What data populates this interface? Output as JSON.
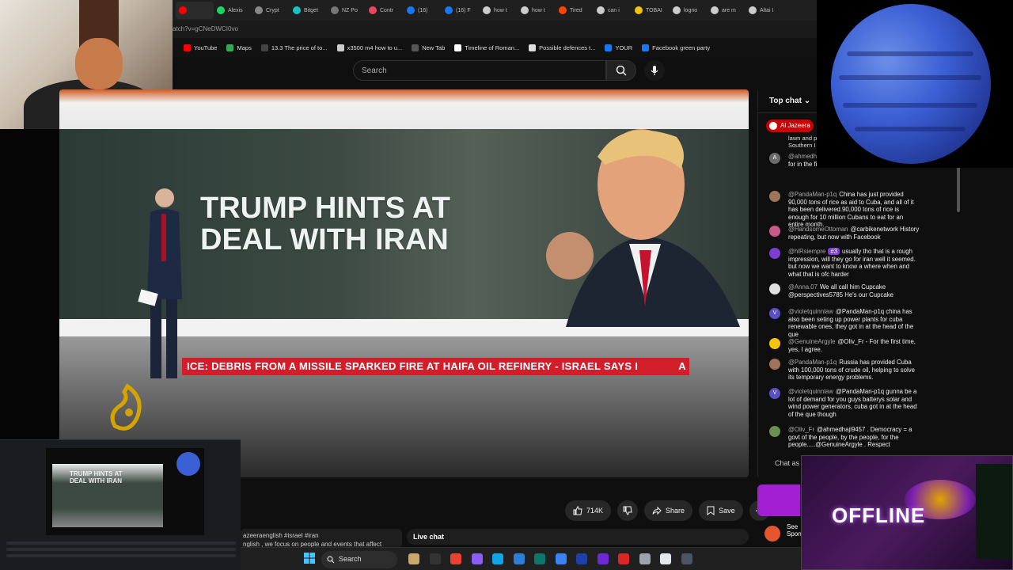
{
  "browser": {
    "tabs": [
      {
        "label": "",
        "color": "#ff0000"
      },
      {
        "label": "Alexis",
        "color": "#1bd760"
      },
      {
        "label": "Crypt",
        "color": "#888888"
      },
      {
        "label": "Bitget",
        "color": "#15c3c3"
      },
      {
        "label": "NZ Po",
        "color": "#777777"
      },
      {
        "label": "Contr",
        "color": "#e94560"
      },
      {
        "label": "(16)",
        "color": "#1877f2"
      },
      {
        "label": "(16) F",
        "color": "#1877f2"
      },
      {
        "label": "how t",
        "color": "#cccccc"
      },
      {
        "label": "how t",
        "color": "#cccccc"
      },
      {
        "label": "Tired",
        "color": "#ff4500"
      },
      {
        "label": "can i",
        "color": "#cccccc"
      },
      {
        "label": "TOBAI",
        "color": "#f4c20d"
      },
      {
        "label": "logno",
        "color": "#cccccc"
      },
      {
        "label": "are m",
        "color": "#cccccc"
      },
      {
        "label": "Altai I",
        "color": "#cccccc"
      }
    ],
    "url": "atch?v=gCNeDWCI0vo",
    "bookmarks": [
      {
        "label": "YouTube",
        "color": "#ff0000"
      },
      {
        "label": "Maps",
        "color": "#34a853"
      },
      {
        "label": "13.3 The price of to...",
        "color": "#444444"
      },
      {
        "label": "x3500 m4 how to u...",
        "color": "#cccccc"
      },
      {
        "label": "New Tab",
        "color": "#555555"
      },
      {
        "label": "Timeline of Roman...",
        "color": "#ffffff"
      },
      {
        "label": "Possible defences t...",
        "color": "#dddddd"
      },
      {
        "label": "YOUR",
        "color": "#1877f2"
      },
      {
        "label": "Facebook green party",
        "color": "#1877f2"
      }
    ]
  },
  "youtube": {
    "search_placeholder": "Search",
    "video": {
      "headline_line1": "TRUMP HINTS AT",
      "headline_line2": "DEAL WITH IRAN",
      "ticker": "ICE: DEBRIS FROM A MISSILE SPARKED FIRE AT HAIFA OIL REFINERY  -  ISRAEL SAYS I",
      "ticker_tail": "A"
    },
    "actions": {
      "likes": "714K",
      "share": "Share",
      "save": "Save"
    },
    "description": "azeeraenglish #israel #iran",
    "description2": "nglish , we focus on people and events that affect",
    "live_chat_button": "Live chat",
    "chat": {
      "header": "Top chat",
      "pinned_channel": "Al Jazeera",
      "pinned_text": "lawn and p Southern I",
      "input_placeholder": "Chat as",
      "messages": [
        {
          "author": "@ahmedh",
          "text": "about you you think he was voted for in the first place?? to serve people??",
          "avatar": "#6c6c6c",
          "initial": "A"
        },
        {
          "author": "@PandaMan-p1q",
          "text": "China has just provided 90,000 tons of rice as aid to Cuba, and all of it has been delivered.90,000 tons of rice is enough for 10 million Cubans to eat for an entire month.",
          "avatar": "#a0745a",
          "initial": ""
        },
        {
          "author": "@HandsomeOttoman",
          "text": "@carbikenetwork History repeating, but now with Facebook",
          "avatar": "#c85a8a",
          "initial": ""
        },
        {
          "author": "@hlRsiempre",
          "text": "usually tho that is a rough impression, will they go for iran well it seemed. but now we want to know a where when and what that is ofc harder",
          "avatar": "#7a3fd0",
          "initial": "",
          "badge": "#3"
        },
        {
          "author": "@Anna.07",
          "text": "We all call him Cupcake @perspectives5785 He's our Cupcake",
          "avatar": "#e0e0e0",
          "initial": ""
        },
        {
          "author": "@violetquinnlaw",
          "text": "@PandaMan-p1q china has also been seting up power plants for cuba renewable ones, they got in at the head of the que",
          "avatar": "#5b4fc4",
          "initial": "V"
        },
        {
          "author": "@GenuineArgyle",
          "text": "@Oliv_Fr - For the first time, yes, I agree.",
          "avatar": "#f4c20d",
          "initial": ""
        },
        {
          "author": "@PandaMan-p1q",
          "text": "Russia has provided Cuba with 100,000 tons of crude oil, helping to solve its temporary energy problems.",
          "avatar": "#a0745a",
          "initial": ""
        },
        {
          "author": "@violetquinnlaw",
          "text": "@PandaMan-p1q gunna be a lot of demand for you guys batterys solar and wind power generators, cuba got in at the head of the que though",
          "avatar": "#5b4fc4",
          "initial": "V"
        },
        {
          "author": "@Oliv_Fr",
          "text": "@ahmedhaji9457 . Democracy = a govt of the people, by the people, for the people.....@GenuineArgyle . Respect",
          "avatar": "#6b8f4e",
          "initial": ""
        }
      ]
    },
    "promo": {
      "label": "See",
      "sub": "Spon"
    }
  },
  "overlays": {
    "offline_text": "OFFLINE",
    "obs_mini_title_1": "TRUMP HINTS AT",
    "obs_mini_title_2": "DEAL WITH IRAN"
  },
  "taskbar": {
    "search_label": "Search",
    "icons": [
      "#c9a76a",
      "#333333",
      "#ea4335",
      "#8b5cf6",
      "#0ea5e9",
      "#2e7dd7",
      "#0f766e",
      "#3b82f6",
      "#1e40af",
      "#6d28d9",
      "#dc2626",
      "#9ca3af",
      "#e5e7eb",
      "#4b5563"
    ]
  }
}
